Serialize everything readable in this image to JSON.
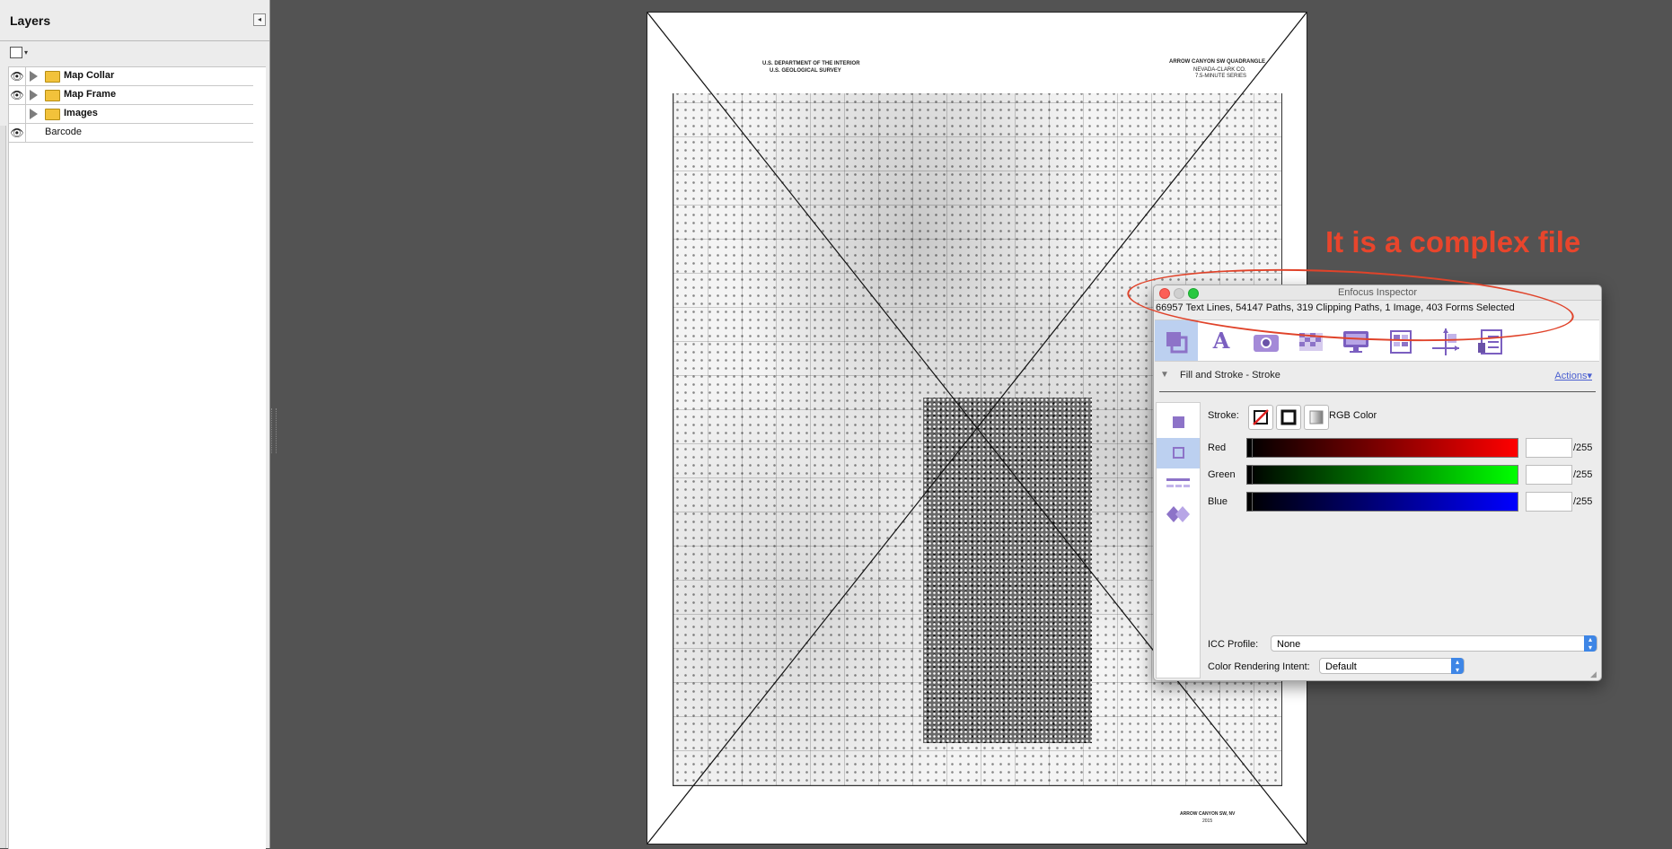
{
  "layers_panel": {
    "title": "Layers",
    "collapse_glyph": "◂",
    "items": [
      {
        "label": "Map Collar",
        "visible": true,
        "expandable": true,
        "folder": true
      },
      {
        "label": "Map Frame",
        "visible": true,
        "expandable": true,
        "folder": true
      },
      {
        "label": "Images",
        "visible": false,
        "expandable": true,
        "folder": true
      },
      {
        "label": "Barcode",
        "visible": true,
        "expandable": false,
        "folder": false
      }
    ]
  },
  "document": {
    "map_header": {
      "agency": "U.S. DEPARTMENT OF THE INTERIOR",
      "survey": "U.S. GEOLOGICAL SURVEY",
      "quad_title": "ARROW CANYON SW QUADRANGLE",
      "state": "NEVADA-CLARK CO.",
      "series": "7.5-MINUTE SERIES"
    },
    "map_footer": {
      "sheet_name": "ARROW CANYON SW, NV",
      "year": "2015"
    }
  },
  "annotation": {
    "text": "It is a complex file",
    "color": "#e8452c"
  },
  "inspector": {
    "title": "Enfocus Inspector",
    "selection_summary": "66957 Text Lines, 54147 Paths, 319 Clipping Paths, 1 Image, 403 Forms Selected",
    "toolbar_icons": [
      "fill-stroke-icon",
      "text-icon",
      "image-icon",
      "transparency-icon",
      "display-icon",
      "forms-icon",
      "position-icon",
      "properties-icon"
    ],
    "section_title": "Fill and Stroke - Stroke",
    "actions_label": "Actions",
    "stroke_label": "Stroke:",
    "color_model": "RGB Color",
    "channels": [
      {
        "label": "Red",
        "value": "",
        "max": "/255",
        "color": "#ff0000"
      },
      {
        "label": "Green",
        "value": "",
        "max": "/255",
        "color": "#00ff00"
      },
      {
        "label": "Blue",
        "value": "",
        "max": "/255",
        "color": "#0000ff"
      }
    ],
    "icc_profile_label": "ICC Profile:",
    "icc_profile_value": "None",
    "rendering_intent_label": "Color Rendering Intent:",
    "rendering_intent_value": "Default"
  },
  "colors": {
    "workspace_bg": "#535353",
    "accent_purple": "#8d73c8",
    "selection_blue": "#bcd0f0"
  }
}
